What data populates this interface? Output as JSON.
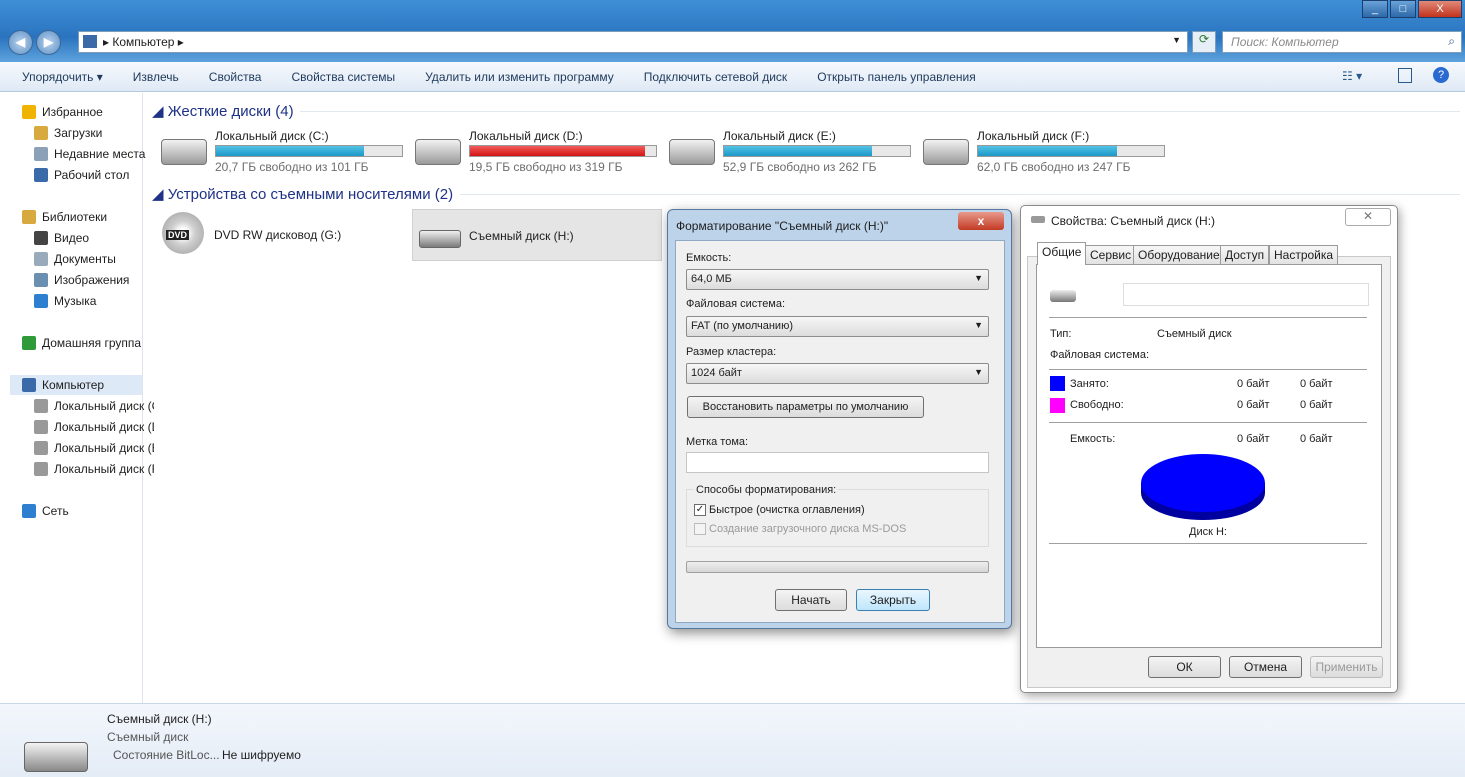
{
  "window": {
    "minimize": "_",
    "maximize": "□",
    "close": "X"
  },
  "address": {
    "path": "Компьютер",
    "search_placeholder": "Поиск: Компьютер"
  },
  "toolbar": {
    "items": [
      "Упорядочить ▾",
      "Извлечь",
      "Свойства",
      "Свойства системы",
      "Удалить или изменить программу",
      "Подключить сетевой диск",
      "Открыть панель управления"
    ]
  },
  "sidebar": {
    "items": [
      {
        "label": "Избранное",
        "icon": "star-icon",
        "color": "#f0b400"
      },
      {
        "label": "Загрузки",
        "icon": "downloads-folder-icon",
        "color": "#d8a93e"
      },
      {
        "label": "Недавние места",
        "icon": "recent-places-icon",
        "color": "#8aa1b8"
      },
      {
        "label": "Рабочий стол",
        "icon": "desktop-icon",
        "color": "#3a6aa8"
      },
      {
        "label": "Библиотеки",
        "icon": "libraries-icon",
        "color": "#d8a93e"
      },
      {
        "label": "Видео",
        "icon": "video-icon",
        "color": "#444"
      },
      {
        "label": "Документы",
        "icon": "documents-icon",
        "color": "#9ab"
      },
      {
        "label": "Изображения",
        "icon": "pictures-icon",
        "color": "#6a8fb0"
      },
      {
        "label": "Музыка",
        "icon": "music-icon",
        "color": "#2f7fd0"
      },
      {
        "label": "Домашняя группа",
        "icon": "homegroup-icon",
        "color": "#2e9a3a"
      },
      {
        "label": "Компьютер",
        "icon": "computer-icon",
        "color": "#3a6aa8"
      },
      {
        "label": "Локальный диск (C:)",
        "icon": "drive-icon",
        "color": "#999"
      },
      {
        "label": "Локальный диск (D:)",
        "icon": "drive-icon",
        "color": "#999"
      },
      {
        "label": "Локальный диск (E:)",
        "icon": "drive-icon",
        "color": "#999"
      },
      {
        "label": "Локальный диск (F:)",
        "icon": "drive-icon",
        "color": "#999"
      },
      {
        "label": "Сеть",
        "icon": "network-icon",
        "color": "#2f7fd0"
      }
    ]
  },
  "main": {
    "hard_disks_title": "Жесткие диски (4)",
    "drives": [
      {
        "name": "Локальный диск (C:)",
        "free": "20,7 ГБ свободно из 101 ГБ",
        "used_percent": 79.5,
        "warning": false
      },
      {
        "name": "Локальный диск (D:)",
        "free": "19,5 ГБ свободно из 319 ГБ",
        "used_percent": 93.9,
        "warning": true
      },
      {
        "name": "Локальный диск (E:)",
        "free": "52,9 ГБ свободно из 262 ГБ",
        "used_percent": 79.8,
        "warning": false
      },
      {
        "name": "Локальный диск (F:)",
        "free": "62,0 ГБ свободно из 247 ГБ",
        "used_percent": 74.9,
        "warning": false
      }
    ],
    "removable_title": "Устройства со съемными носителями (2)",
    "removable": [
      {
        "name": "DVD RW дисковод (G:)",
        "badge": "DVD"
      },
      {
        "name": "Съемный диск (H:)"
      }
    ]
  },
  "details": {
    "name": "Съемный диск (H:)",
    "type": "Съемный диск",
    "bitlocker_label": "Состояние BitLoc...",
    "bitlocker_value": "Не шифруемо"
  },
  "format_dialog": {
    "title": "Форматирование \"Съемный диск (H:)\"",
    "capacity_label": "Емкость:",
    "capacity": "64,0 МБ",
    "fs_label": "Файловая система:",
    "fs": "FAT (по умолчанию)",
    "cluster_label": "Размер кластера:",
    "cluster": "1024 байт",
    "restore": "Восстановить параметры по умолчанию",
    "volume_label": "Метка тома:",
    "volume_value": "",
    "options_label": "Способы форматирования:",
    "quick": "Быстрое (очистка оглавления)",
    "quick_checked": true,
    "msdos": "Создание загрузочного диска MS-DOS",
    "msdos_checked": false,
    "progress": 0,
    "start": "Начать",
    "close": "Закрыть"
  },
  "props_dialog": {
    "title": "Свойства: Съемный диск (H:)",
    "tabs": [
      "Общие",
      "Сервис",
      "Оборудование",
      "Доступ",
      "Настройка"
    ],
    "name_value": "",
    "type_label": "Тип:",
    "type_value": "Съемный диск",
    "fs_label": "Файловая система:",
    "used_label": "Занято:",
    "used_bytes": "0 байт",
    "used_size": "0 байт",
    "used_color": "#0000ff",
    "free_label": "Свободно:",
    "free_bytes": "0 байт",
    "free_size": "0 байт",
    "free_color": "#ff00ff",
    "cap_label": "Емкость:",
    "cap_bytes": "0 байт",
    "cap_size": "0 байт",
    "disk_label": "Диск H:",
    "ok": "ОК",
    "cancel": "Отмена",
    "apply": "Применить"
  }
}
